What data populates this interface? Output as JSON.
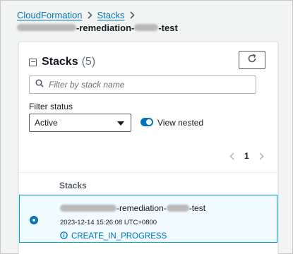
{
  "breadcrumb": {
    "items": [
      "CloudFormation",
      "Stacks"
    ],
    "current_name_middle": "-remediation-",
    "current_name_suffix": "-test"
  },
  "panel": {
    "title": "Stacks",
    "count": "(5)",
    "search_placeholder": "Filter by stack name",
    "filter_label": "Filter status",
    "filter_value": "Active",
    "toggle_label": "View nested",
    "toggle_on": true,
    "page_number": "1"
  },
  "table": {
    "column_header": "Stacks",
    "rows": [
      {
        "name_middle": "-remediation-",
        "name_suffix": "-test",
        "date": "2023-12-14 15:26:08 UTC+0800",
        "status": "CREATE_IN_PROGRESS",
        "selected": true
      }
    ]
  },
  "colors": {
    "link": "#0073bb",
    "selected_row_bg": "#f1faff",
    "selected_row_border": "#00a1c9"
  },
  "icons": [
    "chevron-right-icon",
    "minus-square-icon",
    "refresh-icon",
    "search-icon",
    "caret-down-icon",
    "chevron-left-icon",
    "info-circle-icon"
  ]
}
